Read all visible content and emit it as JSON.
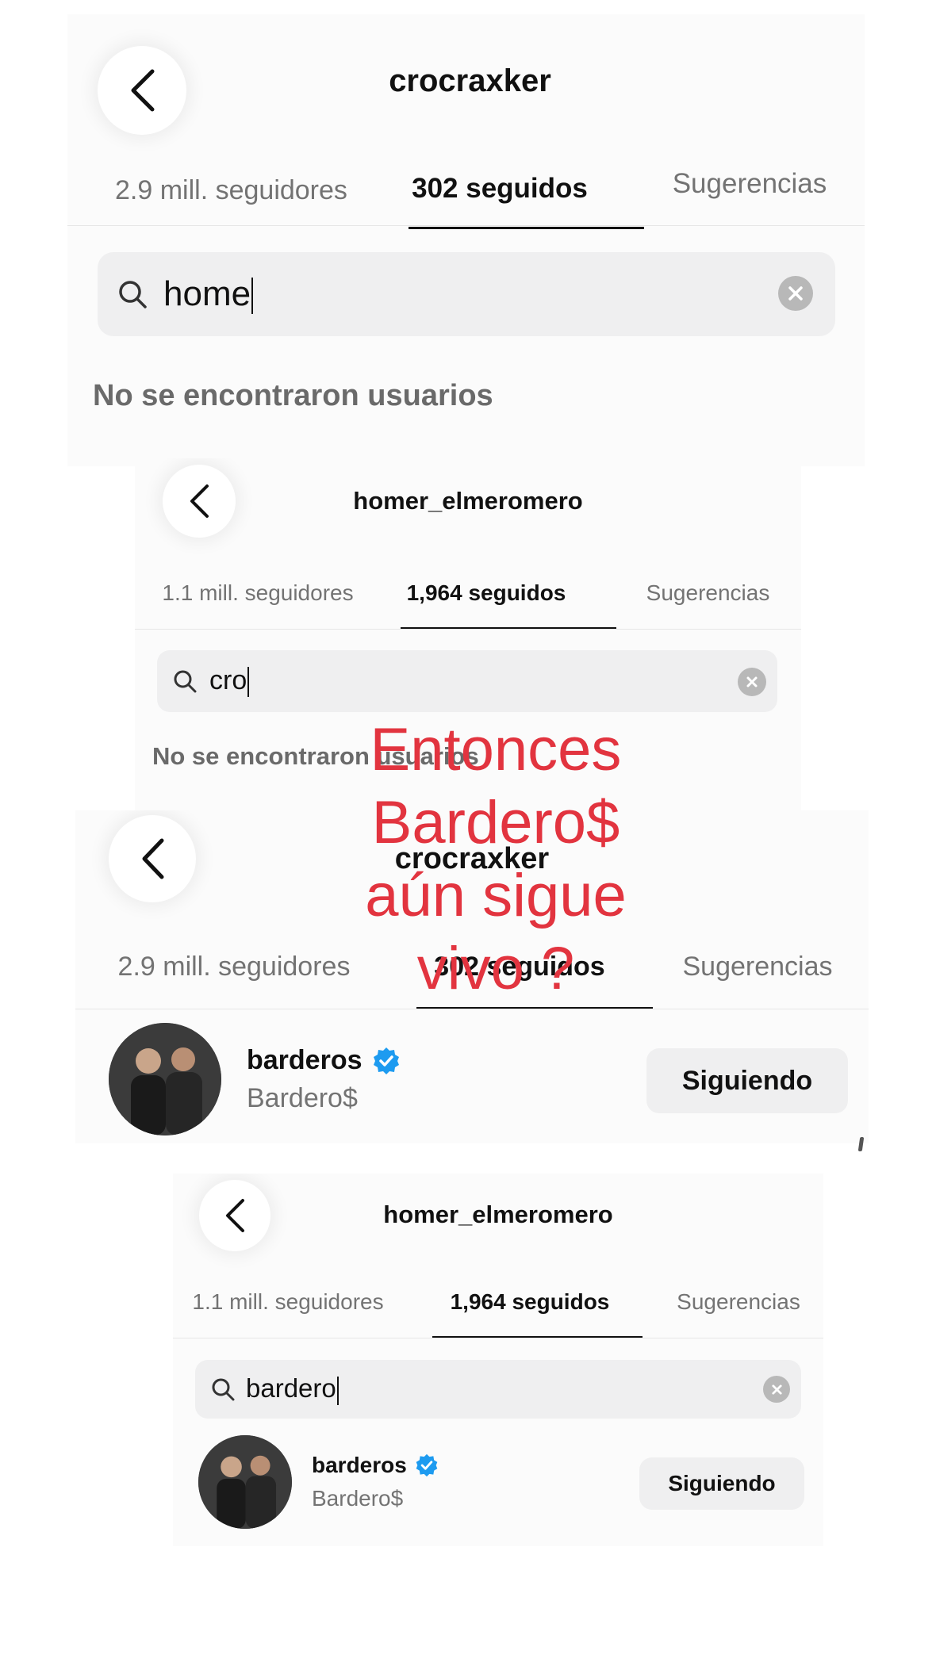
{
  "panels": [
    {
      "username": "crocraxker",
      "tabs": [
        {
          "label": "2.9 mill. seguidores",
          "active": false
        },
        {
          "label": "302 seguidos",
          "active": true
        },
        {
          "label": "Sugerencias",
          "active": false
        }
      ],
      "search_value": "home",
      "empty_text": "No se encontraron usuarios"
    },
    {
      "username": "homer_elmeromero",
      "tabs": [
        {
          "label": "1.1 mill. seguidores",
          "active": false
        },
        {
          "label": "1,964 seguidos",
          "active": true
        },
        {
          "label": "Sugerencias",
          "active": false
        }
      ],
      "search_value": "cro",
      "empty_text": "No se encontraron usuarios"
    },
    {
      "username": "crocraxker",
      "tabs": [
        {
          "label": "2.9 mill. seguidores",
          "active": false
        },
        {
          "label": "302 seguidos",
          "active": true
        },
        {
          "label": "Sugerencias",
          "active": false
        }
      ],
      "result": {
        "username": "barderos",
        "full_name": "Bardero$",
        "button": "Siguiendo"
      }
    },
    {
      "username": "homer_elmeromero",
      "tabs": [
        {
          "label": "1.1 mill. seguidores",
          "active": false
        },
        {
          "label": "1,964 seguidos",
          "active": true
        },
        {
          "label": "Sugerencias",
          "active": false
        }
      ],
      "search_value": "bardero",
      "result": {
        "username": "barderos",
        "full_name": "Bardero$",
        "button": "Siguiendo"
      }
    }
  ],
  "overlay_text": [
    "Entonces",
    "Bardero$",
    "aún sigue",
    "vivo ?"
  ],
  "colors": {
    "overlay": "#e2343f",
    "verified": "#1d9bf0",
    "active_tab": "#111111",
    "inactive_tab": "#737373"
  }
}
